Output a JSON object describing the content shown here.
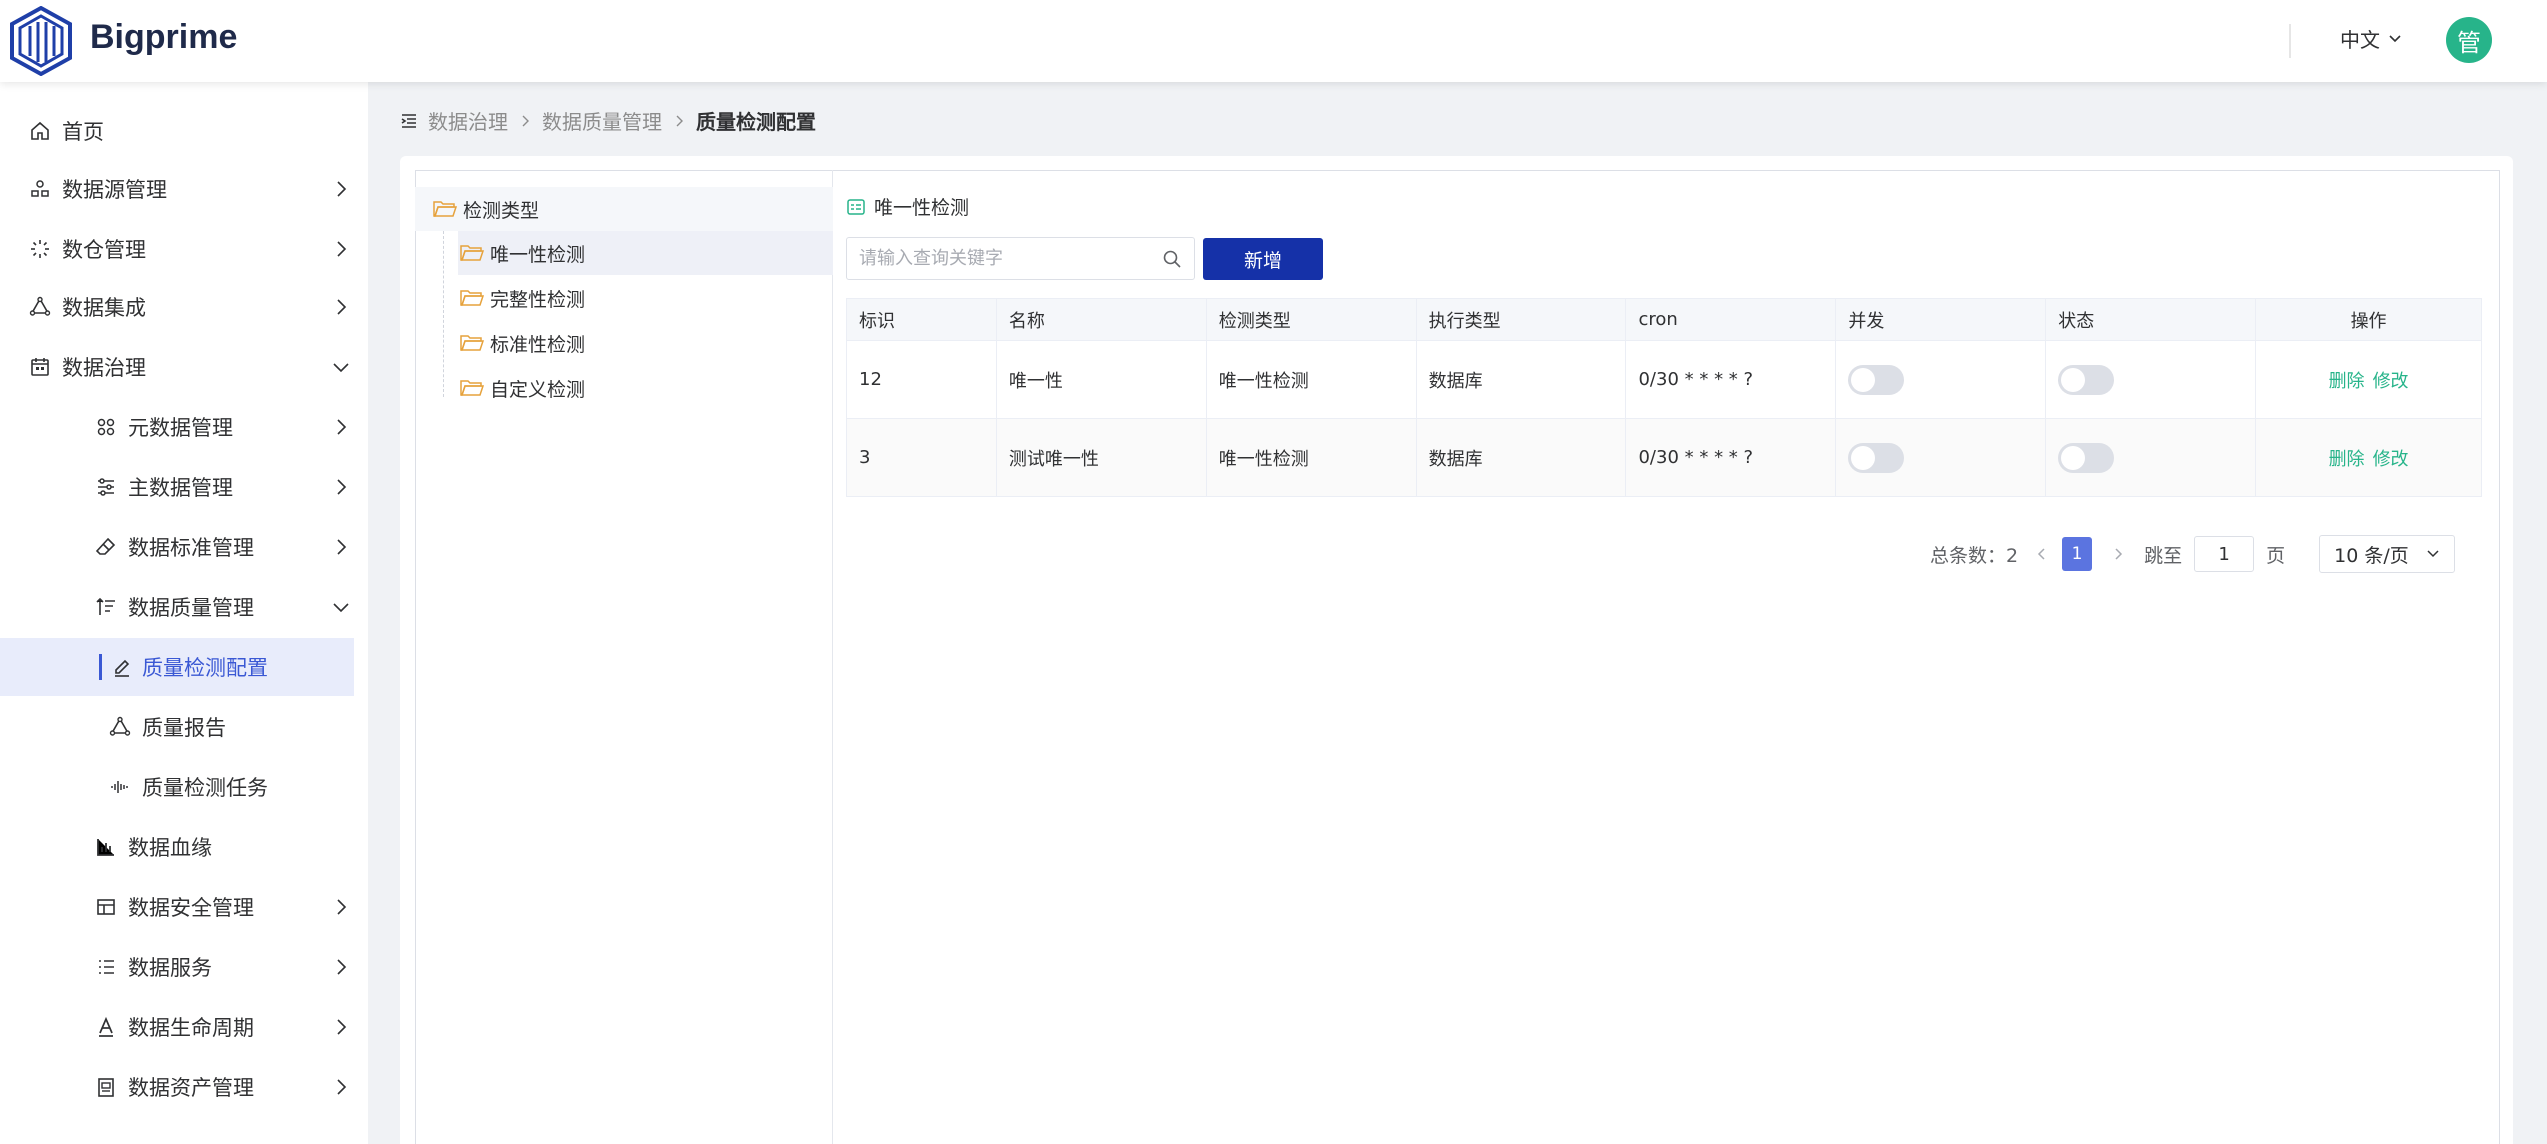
{
  "header": {
    "brand": "Bigprime",
    "language": "中文",
    "avatar_text": "管"
  },
  "sidebar": {
    "items": [
      {
        "label": "首页",
        "icon": "home-icon"
      },
      {
        "label": "数据源管理",
        "icon": "datasource-icon"
      },
      {
        "label": "数仓管理",
        "icon": "warehouse-icon"
      },
      {
        "label": "数据集成",
        "icon": "integration-icon"
      },
      {
        "label": "数据治理",
        "icon": "calendar-icon"
      },
      {
        "label": "元数据管理",
        "icon": "metadata-icon"
      },
      {
        "label": "主数据管理",
        "icon": "sliders-icon"
      },
      {
        "label": "数据标准管理",
        "icon": "eraser-icon"
      },
      {
        "label": "数据质量管理",
        "icon": "sort-icon"
      },
      {
        "label": "质量检测配置",
        "icon": "edit-icon"
      },
      {
        "label": "质量报告",
        "icon": "triangle-icon"
      },
      {
        "label": "质量检测任务",
        "icon": "wave-icon"
      },
      {
        "label": "数据血缘",
        "icon": "chart-icon"
      },
      {
        "label": "数据安全管理",
        "icon": "table-icon"
      },
      {
        "label": "数据服务",
        "icon": "list-icon"
      },
      {
        "label": "数据生命周期",
        "icon": "text-icon"
      },
      {
        "label": "数据资产管理",
        "icon": "asset-icon"
      }
    ]
  },
  "breadcrumb": {
    "items": [
      "数据治理",
      "数据质量管理",
      "质量检测配置"
    ]
  },
  "tree": {
    "root": "检测类型",
    "children": [
      "唯一性检测",
      "完整性检测",
      "标准性检测",
      "自定义检测"
    ]
  },
  "panel": {
    "title": "唯一性检测",
    "search_placeholder": "请输入查询关键字",
    "add_label": "新增"
  },
  "table": {
    "headers": [
      "标识",
      "名称",
      "检测类型",
      "执行类型",
      "cron",
      "并发",
      "状态",
      "操作"
    ],
    "rows": [
      {
        "id": "12",
        "name": "唯一性",
        "type": "唯一性检测",
        "exec": "数据库",
        "cron": "0/30 * * * * ?"
      },
      {
        "id": "3",
        "name": "测试唯一性",
        "type": "唯一性检测",
        "exec": "数据库",
        "cron": "0/30 * * * * ?"
      }
    ],
    "delete_label": "删除",
    "edit_label": "修改"
  },
  "pager": {
    "total_label": "总条数：2",
    "current_page": "1",
    "jump_label": "跳至",
    "jump_value": "1",
    "page_unit": "页",
    "page_size": "10 条/页"
  },
  "colors": {
    "brand": "#1531a8",
    "accent": "#3a58d4",
    "link": "#27b48a",
    "avatar": "#27b48a"
  }
}
